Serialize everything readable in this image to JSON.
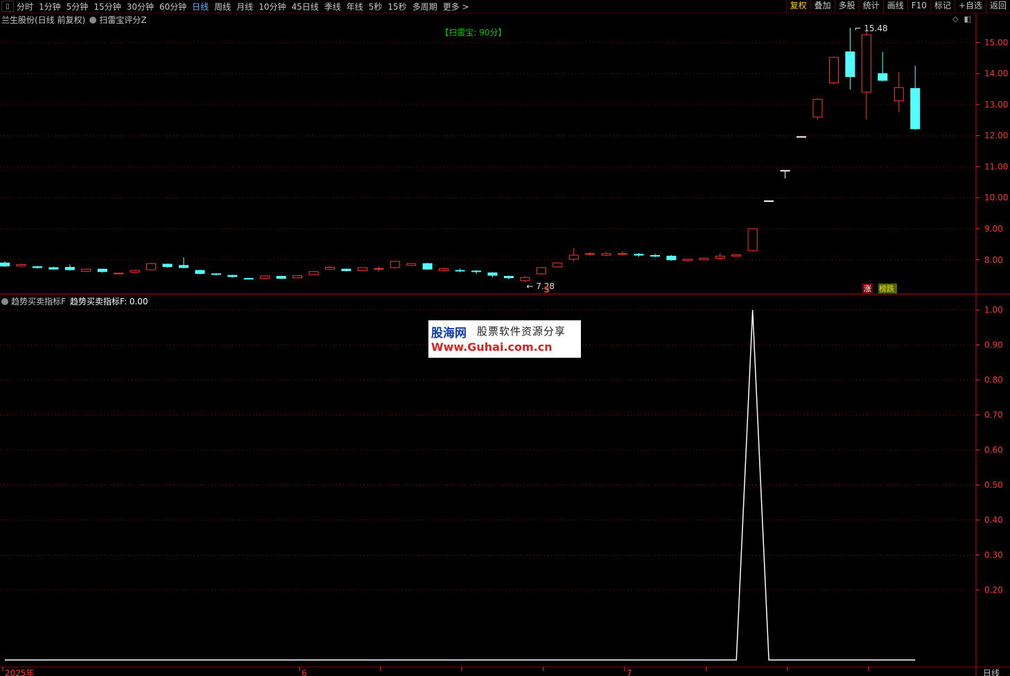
{
  "toolbar": {
    "periods": [
      "分时",
      "1分钟",
      "5分钟",
      "15分钟",
      "30分钟",
      "60分钟",
      "日线",
      "周线",
      "月线",
      "10分钟",
      "45日线",
      "季线",
      "年线",
      "5秒",
      "15秒",
      "多周期",
      "更多 >"
    ],
    "active_period": "日线",
    "right_buttons": [
      "复权",
      "叠加",
      "多股",
      "统计",
      "画线",
      "F10",
      "标记",
      "+自选",
      "返回"
    ],
    "active_right": "复权"
  },
  "main_panel": {
    "stock_title": "兰生股份(日线 前复权)",
    "indicator_name": "扫雷宝评分Z",
    "score_label": "【扫雷宝: 90分】",
    "high_marker": "15.48",
    "low_marker": "7.28",
    "s_marker": "S",
    "tag_rise": "涨",
    "tag_fall": "榜跌"
  },
  "sub_panel": {
    "indicator_name": "趋势买卖指标F",
    "value_label": "趋势买卖指标F: 0.00"
  },
  "watermark": {
    "site_cn": "股海网",
    "slogan": "股票软件资源分享",
    "url": "Www.Guhai.com.cn"
  },
  "bottom_axis": {
    "labels": [
      "2025年",
      "6",
      "7"
    ],
    "period": "日线"
  },
  "colors": {
    "up": "#ff3232",
    "down": "#54ffff",
    "flat": "#ffffff",
    "grid": "#8b0000",
    "axis_text": "#ff3232",
    "line": "#ffffff",
    "score": "#00c800"
  },
  "chart_data": [
    {
      "type": "candlestick",
      "title": "兰生股份(日线 前复权)",
      "y_ticks": [
        8.0,
        9.0,
        10.0,
        11.0,
        12.0,
        13.0,
        14.0,
        15.0
      ],
      "ylim": [
        6.9,
        15.7
      ],
      "candles": [
        {
          "o": 7.9,
          "c": 7.8,
          "h": 7.95,
          "l": 7.77
        },
        {
          "o": 7.8,
          "c": 7.85,
          "h": 7.88,
          "l": 7.78
        },
        {
          "o": 7.78,
          "c": 7.75,
          "h": 7.8,
          "l": 7.72
        },
        {
          "o": 7.75,
          "c": 7.7,
          "h": 7.78,
          "l": 7.68
        },
        {
          "o": 7.76,
          "c": 7.68,
          "h": 7.85,
          "l": 7.65
        },
        {
          "o": 7.63,
          "c": 7.7,
          "h": 7.72,
          "l": 7.6
        },
        {
          "o": 7.7,
          "c": 7.62,
          "h": 7.72,
          "l": 7.58
        },
        {
          "o": 7.56,
          "c": 7.57,
          "h": 7.58,
          "l": 7.54
        },
        {
          "o": 7.6,
          "c": 7.66,
          "h": 7.68,
          "l": 7.58
        },
        {
          "o": 7.68,
          "c": 7.88,
          "h": 7.9,
          "l": 7.66
        },
        {
          "o": 7.86,
          "c": 7.78,
          "h": 7.88,
          "l": 7.75
        },
        {
          "o": 7.82,
          "c": 7.75,
          "h": 8.08,
          "l": 7.73
        },
        {
          "o": 7.66,
          "c": 7.56,
          "h": 7.68,
          "l": 7.53
        },
        {
          "o": 7.55,
          "c": 7.53,
          "h": 7.57,
          "l": 7.5
        },
        {
          "o": 7.5,
          "c": 7.46,
          "h": 7.52,
          "l": 7.42
        },
        {
          "o": 7.4,
          "c": 7.39,
          "h": 7.41,
          "l": 7.37
        },
        {
          "o": 7.4,
          "c": 7.48,
          "h": 7.5,
          "l": 7.38
        },
        {
          "o": 7.47,
          "c": 7.4,
          "h": 7.49,
          "l": 7.38
        },
        {
          "o": 7.42,
          "c": 7.49,
          "h": 7.5,
          "l": 7.41
        },
        {
          "o": 7.52,
          "c": 7.62,
          "h": 7.64,
          "l": 7.5
        },
        {
          "o": 7.7,
          "c": 7.76,
          "h": 7.8,
          "l": 7.68
        },
        {
          "o": 7.7,
          "c": 7.65,
          "h": 7.72,
          "l": 7.62
        },
        {
          "o": 7.65,
          "c": 7.75,
          "h": 7.76,
          "l": 7.63
        },
        {
          "o": 7.7,
          "c": 7.72,
          "h": 7.78,
          "l": 7.62
        },
        {
          "o": 7.75,
          "c": 7.95,
          "h": 7.97,
          "l": 7.72
        },
        {
          "o": 7.82,
          "c": 7.88,
          "h": 7.89,
          "l": 7.8
        },
        {
          "o": 7.88,
          "c": 7.7,
          "h": 7.9,
          "l": 7.68
        },
        {
          "o": 7.65,
          "c": 7.72,
          "h": 7.75,
          "l": 7.62
        },
        {
          "o": 7.66,
          "c": 7.65,
          "h": 7.72,
          "l": 7.6
        },
        {
          "o": 7.64,
          "c": 7.63,
          "h": 7.67,
          "l": 7.55
        },
        {
          "o": 7.58,
          "c": 7.5,
          "h": 7.6,
          "l": 7.44
        },
        {
          "o": 7.47,
          "c": 7.42,
          "h": 7.49,
          "l": 7.37
        },
        {
          "o": 7.33,
          "c": 7.43,
          "h": 7.48,
          "l": 7.28
        },
        {
          "o": 7.55,
          "c": 7.75,
          "h": 7.77,
          "l": 7.52
        },
        {
          "o": 7.77,
          "c": 7.9,
          "h": 7.92,
          "l": 7.75
        },
        {
          "o": 8.02,
          "c": 8.15,
          "h": 8.38,
          "l": 7.95
        },
        {
          "o": 8.18,
          "c": 8.2,
          "h": 8.25,
          "l": 8.14
        },
        {
          "o": 8.15,
          "c": 8.2,
          "h": 8.25,
          "l": 8.12
        },
        {
          "o": 8.18,
          "c": 8.2,
          "h": 8.28,
          "l": 8.15
        },
        {
          "o": 8.18,
          "c": 8.15,
          "h": 8.22,
          "l": 8.1
        },
        {
          "o": 8.14,
          "c": 8.13,
          "h": 8.2,
          "l": 8.08
        },
        {
          "o": 8.12,
          "c": 8.0,
          "h": 8.15,
          "l": 7.97
        },
        {
          "o": 7.98,
          "c": 8.02,
          "h": 8.03,
          "l": 7.96
        },
        {
          "o": 8.0,
          "c": 8.05,
          "h": 8.06,
          "l": 7.98
        },
        {
          "o": 8.05,
          "c": 8.12,
          "h": 8.22,
          "l": 8.02
        },
        {
          "o": 8.12,
          "c": 8.16,
          "h": 8.18,
          "l": 8.1
        },
        {
          "o": 8.3,
          "c": 9.0,
          "h": 9.02,
          "l": 8.28
        },
        {
          "o": 9.9,
          "c": 9.9,
          "h": 9.9,
          "l": 9.9
        },
        {
          "o": 10.88,
          "c": 10.88,
          "h": 10.88,
          "l": 10.62
        },
        {
          "o": 11.97,
          "c": 11.97,
          "h": 11.97,
          "l": 11.97
        },
        {
          "o": 12.6,
          "c": 13.17,
          "h": 13.2,
          "l": 12.52
        },
        {
          "o": 13.7,
          "c": 14.52,
          "h": 14.55,
          "l": 13.65
        },
        {
          "o": 14.7,
          "c": 13.9,
          "h": 15.48,
          "l": 13.48
        },
        {
          "o": 13.4,
          "c": 15.25,
          "h": 15.35,
          "l": 12.52
        },
        {
          "o": 14.0,
          "c": 13.78,
          "h": 14.7,
          "l": 13.75
        },
        {
          "o": 13.12,
          "c": 13.55,
          "h": 14.05,
          "l": 12.75
        },
        {
          "o": 13.52,
          "c": 12.22,
          "h": 14.25,
          "l": 12.18
        }
      ]
    },
    {
      "type": "line",
      "title": "趋势买卖指标F",
      "y_ticks": [
        0.2,
        0.3,
        0.4,
        0.5,
        0.6,
        0.7,
        0.8,
        0.9,
        1.0
      ],
      "ylim": [
        -0.02,
        1.02
      ],
      "values": [
        0,
        0,
        0,
        0,
        0,
        0,
        0,
        0,
        0,
        0,
        0,
        0,
        0,
        0,
        0,
        0,
        0,
        0,
        0,
        0,
        0,
        0,
        0,
        0,
        0,
        0,
        0,
        0,
        0,
        0,
        0,
        0,
        0,
        0,
        0,
        0,
        0,
        0,
        0,
        0,
        0,
        0,
        0,
        0,
        0,
        0,
        1,
        0,
        0,
        0,
        0,
        0,
        0,
        0,
        0,
        0,
        0
      ]
    }
  ]
}
